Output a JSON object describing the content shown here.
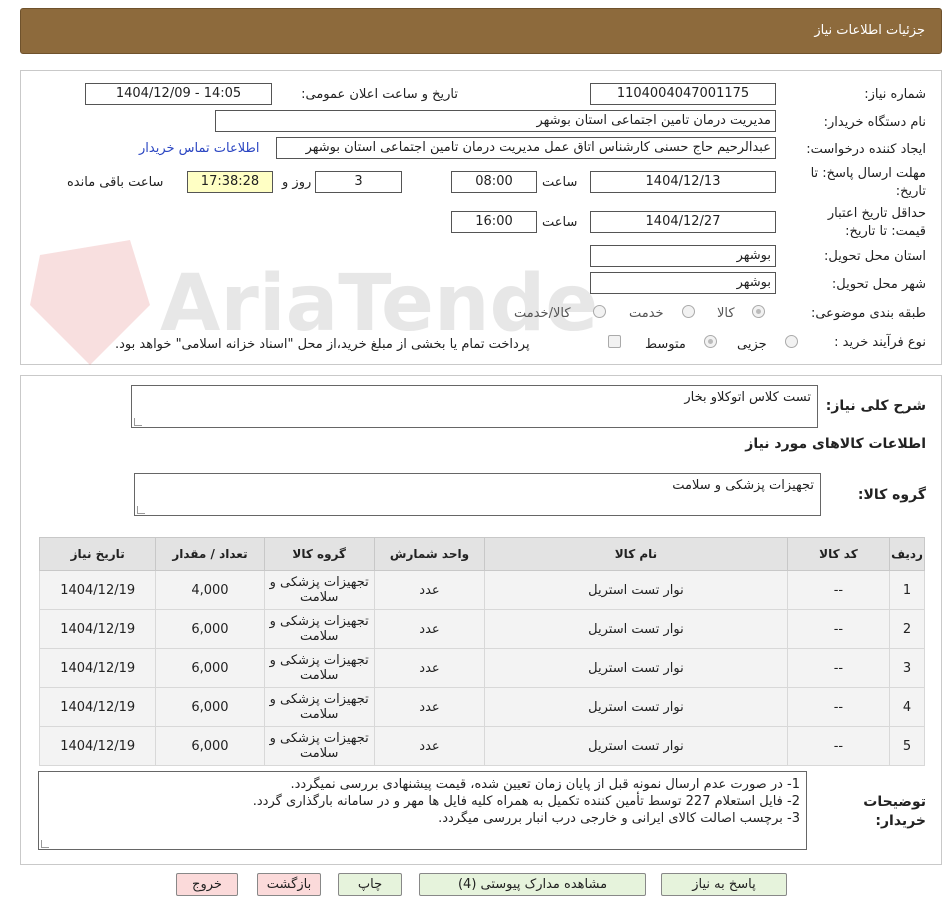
{
  "header": {
    "title": "جزئیات اطلاعات نیاز"
  },
  "watermark": "AriaTender.neT",
  "fields": {
    "need_number_label": "شماره نیاز:",
    "need_number": "1104004047001175",
    "announce_label": "تاریخ و ساعت اعلان عمومی:",
    "announce_value": "1404/12/09 - 14:05",
    "buyer_org_label": "نام دستگاه خریدار:",
    "buyer_org": "مدیریت درمان تامین اجتماعی استان بوشهر",
    "creator_label": "ایجاد کننده درخواست:",
    "creator": "عبدالرحیم حاج حسنی کارشناس اتاق عمل مدیریت درمان تامین اجتماعی استان بوشهر",
    "contact_link": "اطلاعات تماس خریدار",
    "deadline_label": "مهلت ارسال پاسخ: تا تاریخ:",
    "deadline_date": "1404/12/13",
    "time_label": "ساعت",
    "deadline_time": "08:00",
    "days": "3",
    "days_label": "روز و",
    "remaining": "17:38:28",
    "remaining_label": "ساعت باقی مانده",
    "validity_label": "حداقل تاریخ اعتبار قیمت: تا تاریخ:",
    "validity_date": "1404/12/27",
    "validity_time": "16:00",
    "province_label": "استان محل تحویل:",
    "province": "بوشهر",
    "city_label": "شهر محل تحویل:",
    "city": "بوشهر",
    "category_label": "طبقه بندی موضوعی:",
    "category_options": [
      "کالا",
      "خدمت",
      "کالا/خدمت"
    ],
    "process_label": "نوع فرآیند خرید :",
    "process_options": [
      "جزیی",
      "متوسط"
    ],
    "payment_note": "پرداخت تمام یا بخشی از مبلغ خرید،از محل \"اسناد خزانه اسلامی\" خواهد بود."
  },
  "summary": {
    "label": "شرح کلی نیاز:",
    "value": "تست کلاس اتوکلاو بخار",
    "items_title": "اطلاعات کالاهای مورد نیاز",
    "group_label": "گروه کالا:",
    "group_value": "تجهیزات پزشکی و سلامت"
  },
  "table": {
    "headers": [
      "ردیف",
      "کد کالا",
      "نام کالا",
      "واحد شمارش",
      "گروه کالا",
      "تعداد / مقدار",
      "تاریخ نیاز"
    ],
    "rows": [
      [
        "1",
        "--",
        "نوار تست استریل",
        "عدد",
        "تجهیزات پزشکی و سلامت",
        "4,000",
        "1404/12/19"
      ],
      [
        "2",
        "--",
        "نوار تست استریل",
        "عدد",
        "تجهیزات پزشکی و سلامت",
        "6,000",
        "1404/12/19"
      ],
      [
        "3",
        "--",
        "نوار تست استریل",
        "عدد",
        "تجهیزات پزشکی و سلامت",
        "6,000",
        "1404/12/19"
      ],
      [
        "4",
        "--",
        "نوار تست استریل",
        "عدد",
        "تجهیزات پزشکی و سلامت",
        "6,000",
        "1404/12/19"
      ],
      [
        "5",
        "--",
        "نوار تست استریل",
        "عدد",
        "تجهیزات پزشکی و سلامت",
        "6,000",
        "1404/12/19"
      ]
    ]
  },
  "notes": {
    "label": "توضیحات خریدار:",
    "lines": [
      "1- در صورت عدم ارسال نمونه قبل از پایان زمان تعیین شده، قیمت پیشنهادی بررسی نمیگردد.",
      "2- فایل استعلام 227 توسط تأمین کننده تکمیل به همراه کلیه فایل ها مهر و در سامانه بارگذاری گردد.",
      "3- برچسب اصالت کالای ایرانی و خارجی درب انبار بررسی میگردد."
    ]
  },
  "buttons": {
    "reply": "پاسخ به نیاز",
    "attachments": "مشاهده مدارک پیوستی (4)",
    "print": "چاپ",
    "back": "بازگشت",
    "exit": "خروج"
  }
}
